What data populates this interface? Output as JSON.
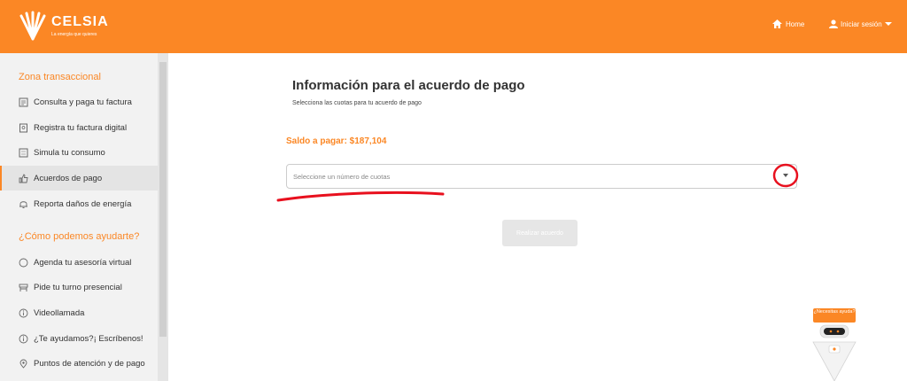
{
  "header": {
    "brand": "CELSIA",
    "tagline": "La energía que quieres",
    "home_label": "Home",
    "login_label": "Iniciar sesión",
    "icons": [
      "celsia-logo-icon",
      "home-icon",
      "user-icon",
      "caret-down-icon"
    ]
  },
  "sidebar": {
    "section1_title": "Zona transaccional",
    "section1_items": [
      {
        "label": "Consulta y paga tu factura",
        "icon": "invoice-icon"
      },
      {
        "label": "Registra tu factura digital",
        "icon": "digital-invoice-icon"
      },
      {
        "label": "Simula tu consumo",
        "icon": "calculator-icon"
      },
      {
        "label": "Acuerdos de pago",
        "icon": "thumbs-up-icon",
        "active": true
      },
      {
        "label": "Reporta daños de energía",
        "icon": "bell-icon"
      }
    ],
    "section2_title": "¿Cómo podemos ayudarte?",
    "section2_items": [
      {
        "label": "Agenda tu asesoría virtual",
        "icon": "clock-icon"
      },
      {
        "label": "Pide tu turno presencial",
        "icon": "ticket-icon"
      },
      {
        "label": "Videollamada",
        "icon": "info-icon"
      },
      {
        "label": "¿Te ayudamos?¡ Escríbenos!",
        "icon": "info-icon"
      },
      {
        "label": "Puntos de atención y de pago",
        "icon": "location-pin-icon"
      }
    ]
  },
  "main": {
    "title": "Información para el acuerdo de pago",
    "subtitle": "Selecciona las cuotas para tu acuerdo de pago",
    "balance": "Saldo a pagar: $187,104",
    "select_placeholder": "Seleccione un número de cuotas",
    "submit_label": "Realizar acuerdo"
  },
  "assistant": {
    "label": "¿Necesitas ayuda?"
  },
  "colors": {
    "brand": "#fb8725",
    "annotation": "#e8101e"
  }
}
